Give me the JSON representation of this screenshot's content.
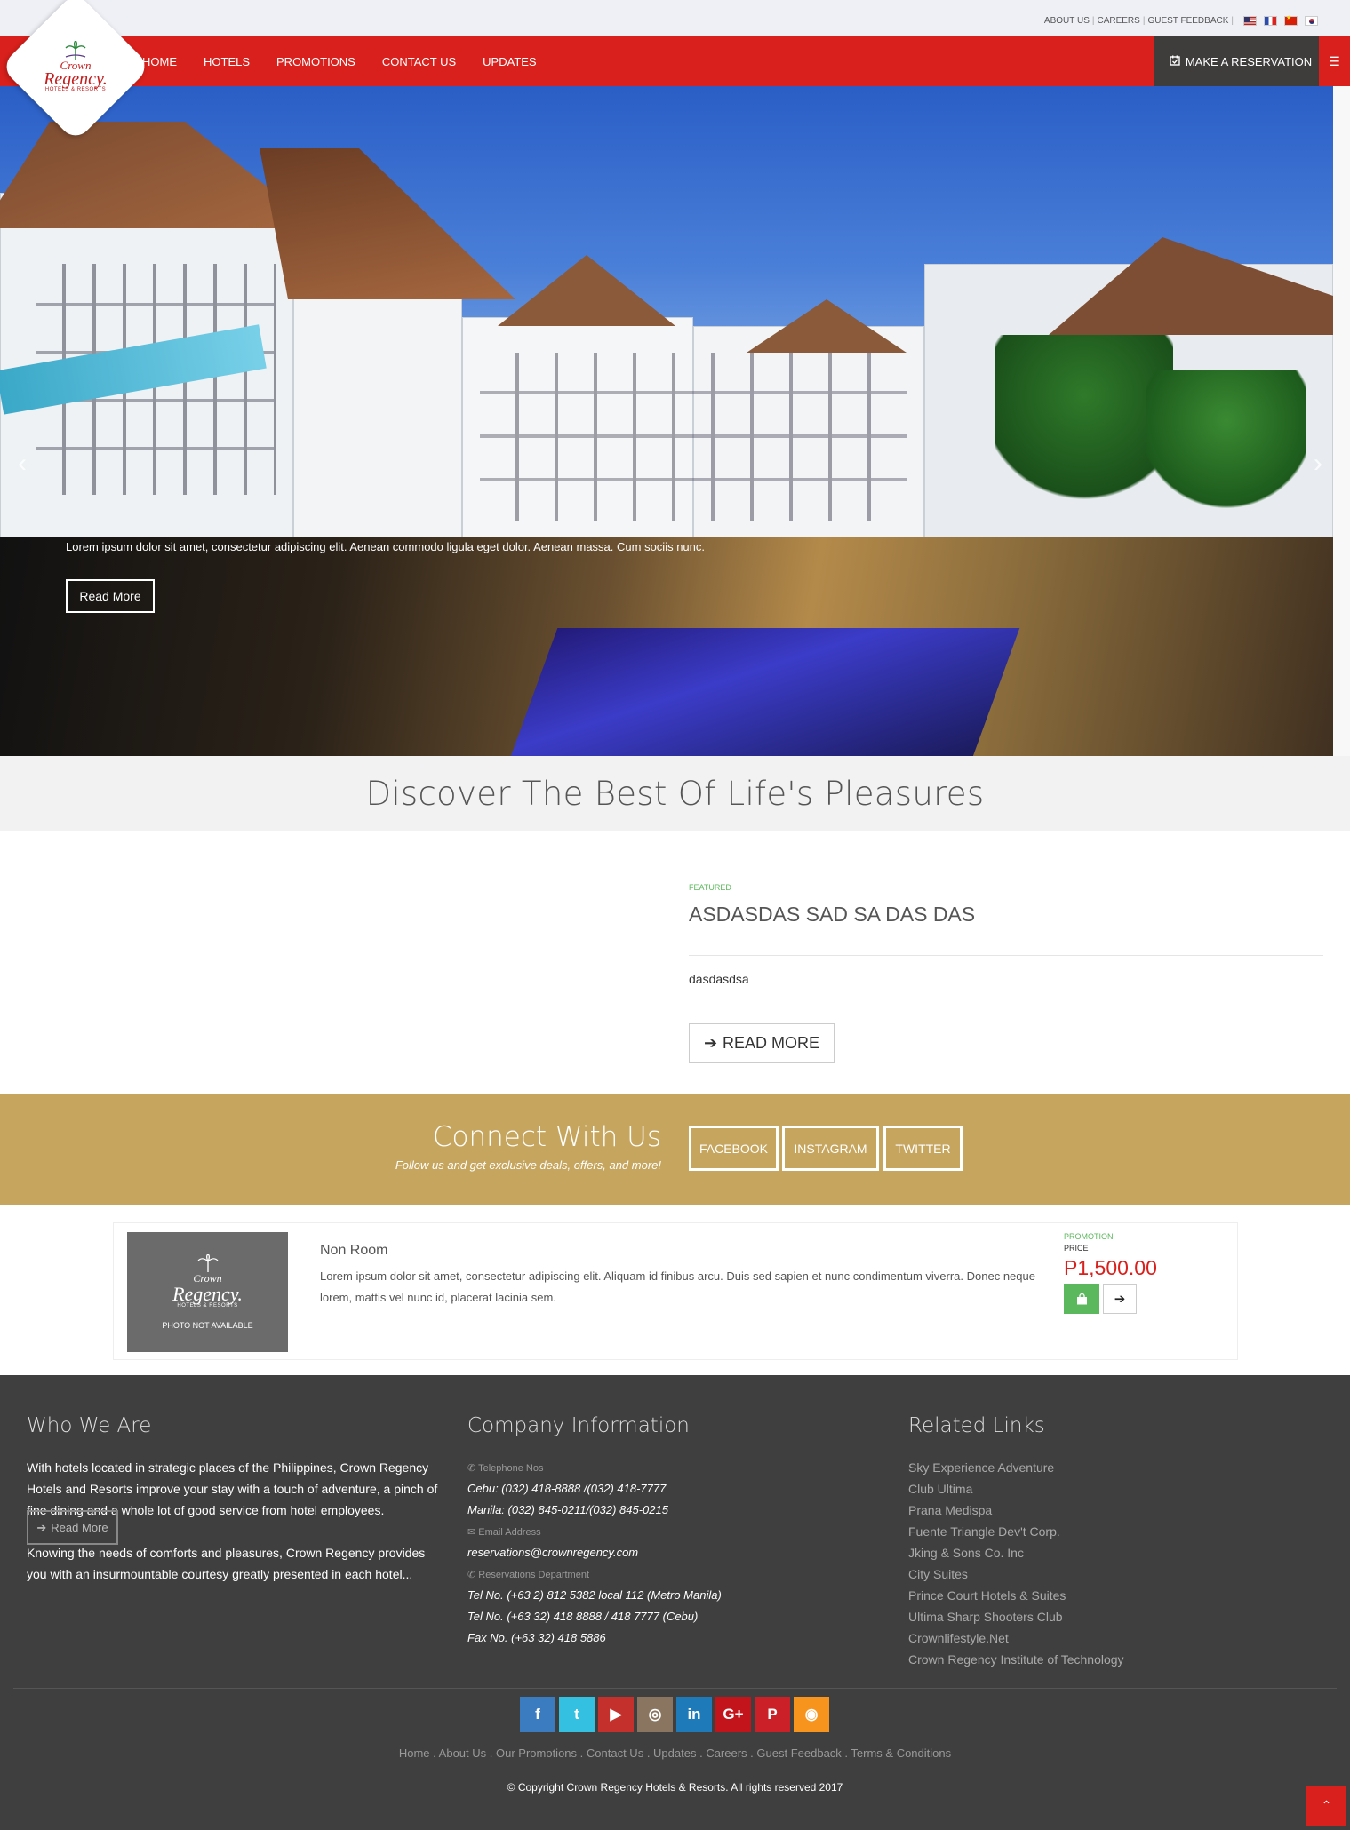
{
  "topbar": {
    "links": [
      "ABOUT US",
      "CAREERS",
      "GUEST FEEDBACK"
    ],
    "flags": [
      "us-flag-icon",
      "france-flag-icon",
      "china-flag-icon",
      "korea-flag-icon"
    ]
  },
  "logo": {
    "line1": "Crown",
    "line2": "Regency.",
    "line3": "HOTELS & RESORTS"
  },
  "nav": {
    "items": [
      "HOME",
      "HOTELS",
      "PROMOTIONS",
      "CONTACT US",
      "UPDATES"
    ],
    "reserve_label": "MAKE A RESERVATION",
    "accent": "#d9201c"
  },
  "hero": {
    "caption": "Lorem ipsum dolor sit amet, consectetur adipiscing elit. Aenean commodo ligula eget dolor. Aenean massa. Cum sociis nunc.",
    "read_more": "Read More"
  },
  "discover": {
    "title": "Discover The Best Of Life's Pleasures"
  },
  "featured": {
    "tag": "FEATURED",
    "title": "ASDASDAS SAD SA DAS DAS",
    "desc": "dasdasdsa",
    "button": "READ MORE"
  },
  "connect": {
    "title": "Connect With Us",
    "subtitle": "Follow us and get exclusive deals, offers, and more!",
    "buttons": [
      "FACEBOOK",
      "INSTAGRAM",
      "TWITTER"
    ],
    "bg": "#c6a55e"
  },
  "promo": {
    "img_line1": "Crown",
    "img_line2": "Regency.",
    "img_line3": "HOTELS & RESORTS",
    "img_caption": "PHOTO NOT AVAILABLE",
    "title": "Non Room",
    "desc": "Lorem ipsum dolor sit amet, consectetur adipiscing elit. Aliquam id finibus arcu. Duis sed sapien et nunc condimentum viverra. Donec neque lorem, mattis vel nunc id, placerat lacinia sem.",
    "tag": "PROMOTION",
    "price_label": "PRICE",
    "price": "P1,500.00"
  },
  "footer": {
    "who_title": "Who We Are",
    "who_p1": "With hotels located in strategic places of the Philippines, Crown Regency Hotels and Resorts improve your stay with a touch of adventure, a pinch of fine dining and a whole lot of good service from hotel employees.",
    "who_p2": "Knowing the needs of comforts and pleasures, Crown Regency provides you with an insurmountable courtesy greatly presented in each hotel...",
    "who_read_more": "Read More",
    "company_title": "Company Information",
    "tel_label": "Telephone Nos",
    "tel_cebu": "Cebu: (032) 418-8888 /(032) 418-7777",
    "tel_manila": "Manila: (032) 845-0211/(032) 845-0215",
    "email_label": "Email Address",
    "email": "reservations@crownregency.com",
    "res_label": "Reservations Department",
    "res_tel1": "Tel No. (+63 2) 812 5382 local 112 (Metro Manila)",
    "res_tel2": "Tel No. (+63 32) 418 8888 / 418 7777 (Cebu)",
    "res_fax": "Fax No. (+63 32) 418 5886",
    "links_title": "Related Links",
    "links": [
      "Sky Experience Adventure",
      "Club Ultima",
      "Prana Medispa",
      "Fuente Triangle Dev't Corp.",
      "Jking & Sons Co. Inc",
      "City Suites",
      "Prince Court Hotels & Suites",
      "Ultima Sharp Shooters Club",
      "Crownlifestyle.Net",
      "Crown Regency Institute of Technology"
    ],
    "social": [
      {
        "name": "facebook-icon",
        "glyph": "f",
        "color": "#3b7bbf"
      },
      {
        "name": "twitter-icon",
        "glyph": "t",
        "color": "#34c0e0"
      },
      {
        "name": "youtube-icon",
        "glyph": "▶",
        "color": "#c4302b"
      },
      {
        "name": "instagram-icon",
        "glyph": "◎",
        "color": "#8a7560"
      },
      {
        "name": "linkedin-icon",
        "glyph": "in",
        "color": "#1e7ab8"
      },
      {
        "name": "google-plus-icon",
        "glyph": "G+",
        "color": "#c4141b"
      },
      {
        "name": "pinterest-icon",
        "glyph": "P",
        "color": "#cb2027"
      },
      {
        "name": "rss-icon",
        "glyph": "◉",
        "color": "#f7941d"
      }
    ],
    "nav_links": [
      "Home",
      "About Us",
      "Our Promotions",
      "Contact Us",
      "Updates",
      "Careers",
      "Guest Feedback",
      "Terms & Conditions"
    ],
    "copyright": "© Copyright Crown Regency Hotels & Resorts. All rights reserved 2017"
  }
}
